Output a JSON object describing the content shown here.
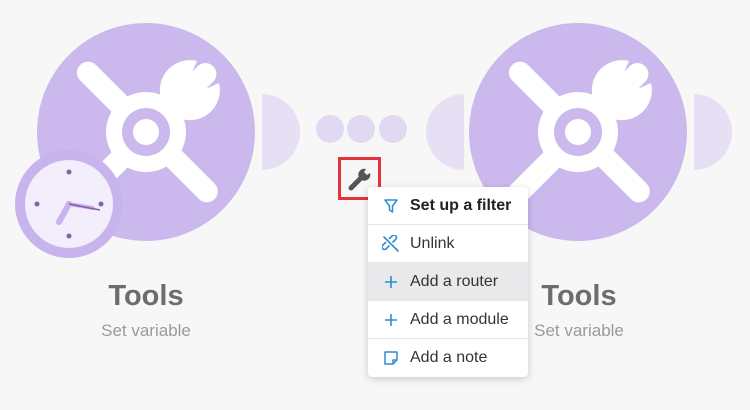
{
  "modules": [
    {
      "title": "Tools",
      "subtitle": "Set variable",
      "icon": "tools-icon",
      "badge": "clock-icon"
    },
    {
      "title": "Tools",
      "subtitle": "Set variable",
      "icon": "tools-icon"
    }
  ],
  "connection": {
    "settings_icon": "wrench-icon"
  },
  "context_menu": {
    "items": [
      {
        "label": "Set up a filter",
        "icon": "filter-icon"
      },
      {
        "label": "Unlink",
        "icon": "unlink-icon"
      },
      {
        "label": "Add a router",
        "icon": "plus-icon"
      },
      {
        "label": "Add a module",
        "icon": "plus-icon"
      },
      {
        "label": "Add a note",
        "icon": "note-icon"
      }
    ]
  },
  "colors": {
    "module": "#cbb9ee",
    "accent": "#2b8dd3",
    "highlight": "#e5323b"
  }
}
